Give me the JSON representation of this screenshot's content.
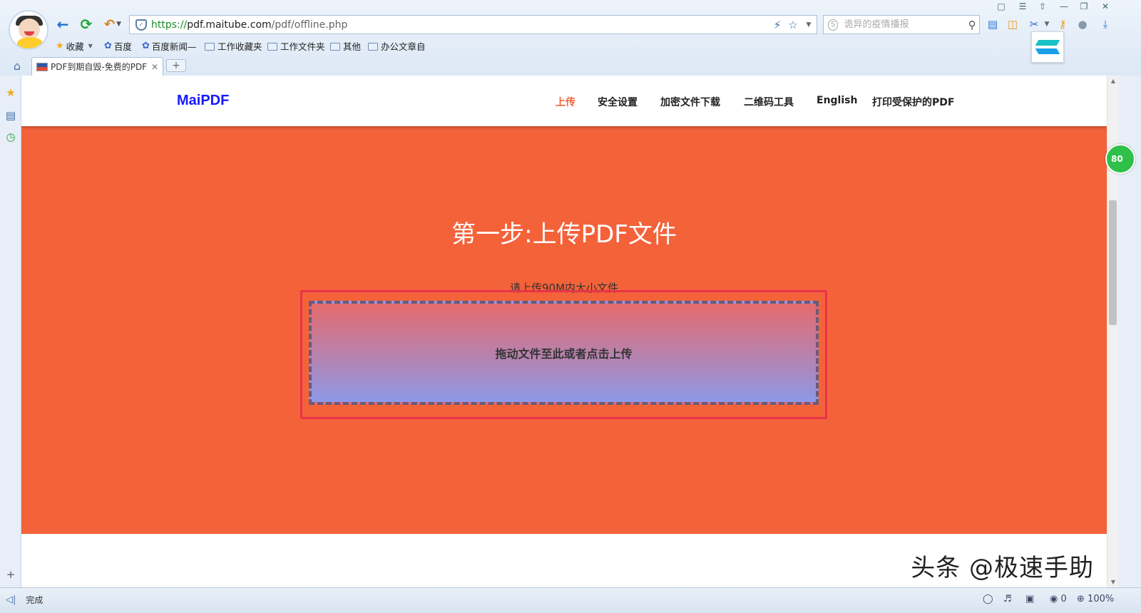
{
  "browser": {
    "address": {
      "protocol": "https://",
      "host": "pdf.maitube.com",
      "rest": "/pdf/offline.php"
    },
    "search_placeholder": "诡异的疫情播报",
    "bookmarks": [
      {
        "label": "收藏",
        "icon": "star-icon"
      },
      {
        "label": "百度",
        "icon": "baidu-paw-icon"
      },
      {
        "label": "百度新闻—",
        "icon": "baidu-paw-icon"
      },
      {
        "label": "工作收藏夹",
        "icon": "folder-icon"
      },
      {
        "label": "工作文件夹",
        "icon": "folder-icon"
      },
      {
        "label": "其他",
        "icon": "folder-icon"
      },
      {
        "label": "办公文章自",
        "icon": "folder-icon"
      }
    ],
    "tab_title": "PDF到期自毁-免费的PDF",
    "new_tab": "+",
    "status": "完成",
    "zoom": "100%",
    "blocked_count": "0",
    "badge": "80"
  },
  "site": {
    "brand": "MaiPDF",
    "menu": [
      "上传",
      "安全设置",
      "加密文件下载",
      "二维码工具",
      "English",
      "打印受保护的PDF"
    ],
    "active_menu": "上传",
    "colors": {
      "hero": "#f4623a",
      "brand": "#1818ff",
      "active": "#f4623a"
    }
  },
  "hero": {
    "heading": "第一步:上传PDF文件",
    "hint": "请上传90M内大小文件",
    "dropzone": "拖动文件至此或者点击上传"
  },
  "watermark": "头条 @极速手助"
}
